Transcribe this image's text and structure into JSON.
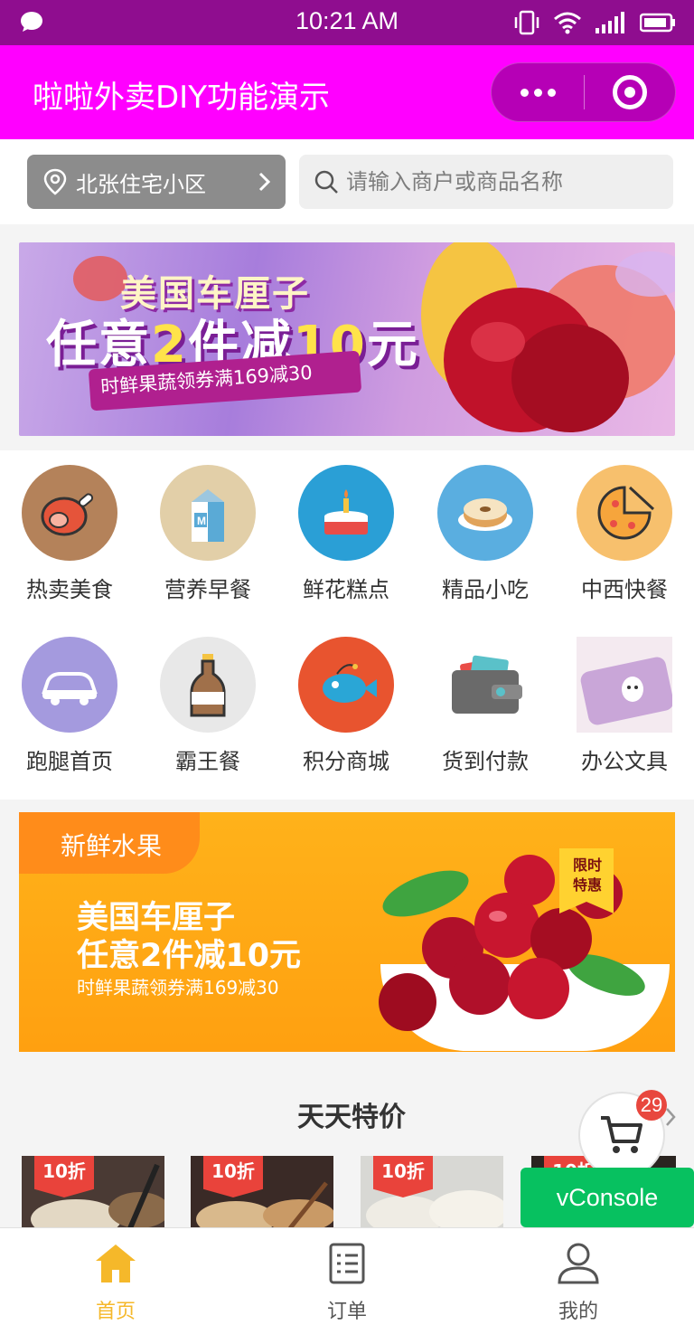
{
  "status_bar": {
    "time": "10:21 AM"
  },
  "nav": {
    "title": "啦啦外卖DIY功能演示"
  },
  "search_row": {
    "location": "北张住宅小区",
    "search_placeholder": "请输入商户或商品名称"
  },
  "banner_top": {
    "line1": "美国车厘子",
    "line2_a": "任意",
    "line2_b": "2",
    "line2_c": "件减",
    "line2_d": "10",
    "line2_e": "元",
    "line3": "时鲜果蔬领券满169减30"
  },
  "categories": [
    {
      "label": "热卖美食",
      "icon": "ham-icon",
      "bg": "#b4825a"
    },
    {
      "label": "营养早餐",
      "icon": "milk-carton-icon",
      "bg": "#e2cfa8"
    },
    {
      "label": "鲜花糕点",
      "icon": "cake-icon",
      "bg": "#2a9fd6"
    },
    {
      "label": "精品小吃",
      "icon": "donut-icon",
      "bg": "#5aaee0"
    },
    {
      "label": "中西快餐",
      "icon": "pizza-icon",
      "bg": "#f7c06d"
    },
    {
      "label": "跑腿首页",
      "icon": "car-icon",
      "bg": "#a49ade"
    },
    {
      "label": "霸王餐",
      "icon": "bottle-icon",
      "bg": "#e8e8e8"
    },
    {
      "label": "积分商城",
      "icon": "fish-icon",
      "bg": "#e8542f"
    },
    {
      "label": "货到付款",
      "icon": "wallet-icon",
      "bg": "#ffffff"
    },
    {
      "label": "办公文具",
      "icon": "pencil-case-icon",
      "bg": "#f3e7ee"
    }
  ],
  "banner_fruit": {
    "tag": "新鲜水果",
    "line1": "美国车厘子",
    "line2": "任意2件减10元",
    "line3": "时鲜果蔬领券满169减30",
    "badge_line1": "限时",
    "badge_line2": "特惠"
  },
  "deals": {
    "title": "天天特价",
    "discount_label": "10折"
  },
  "cart": {
    "count": "29"
  },
  "vconsole": {
    "label": "vConsole"
  },
  "tab_bar": {
    "active_color": "#f5b82a",
    "inactive_color": "#555555",
    "tabs": [
      {
        "label": "首页"
      },
      {
        "label": "订单"
      },
      {
        "label": "我的"
      }
    ]
  }
}
